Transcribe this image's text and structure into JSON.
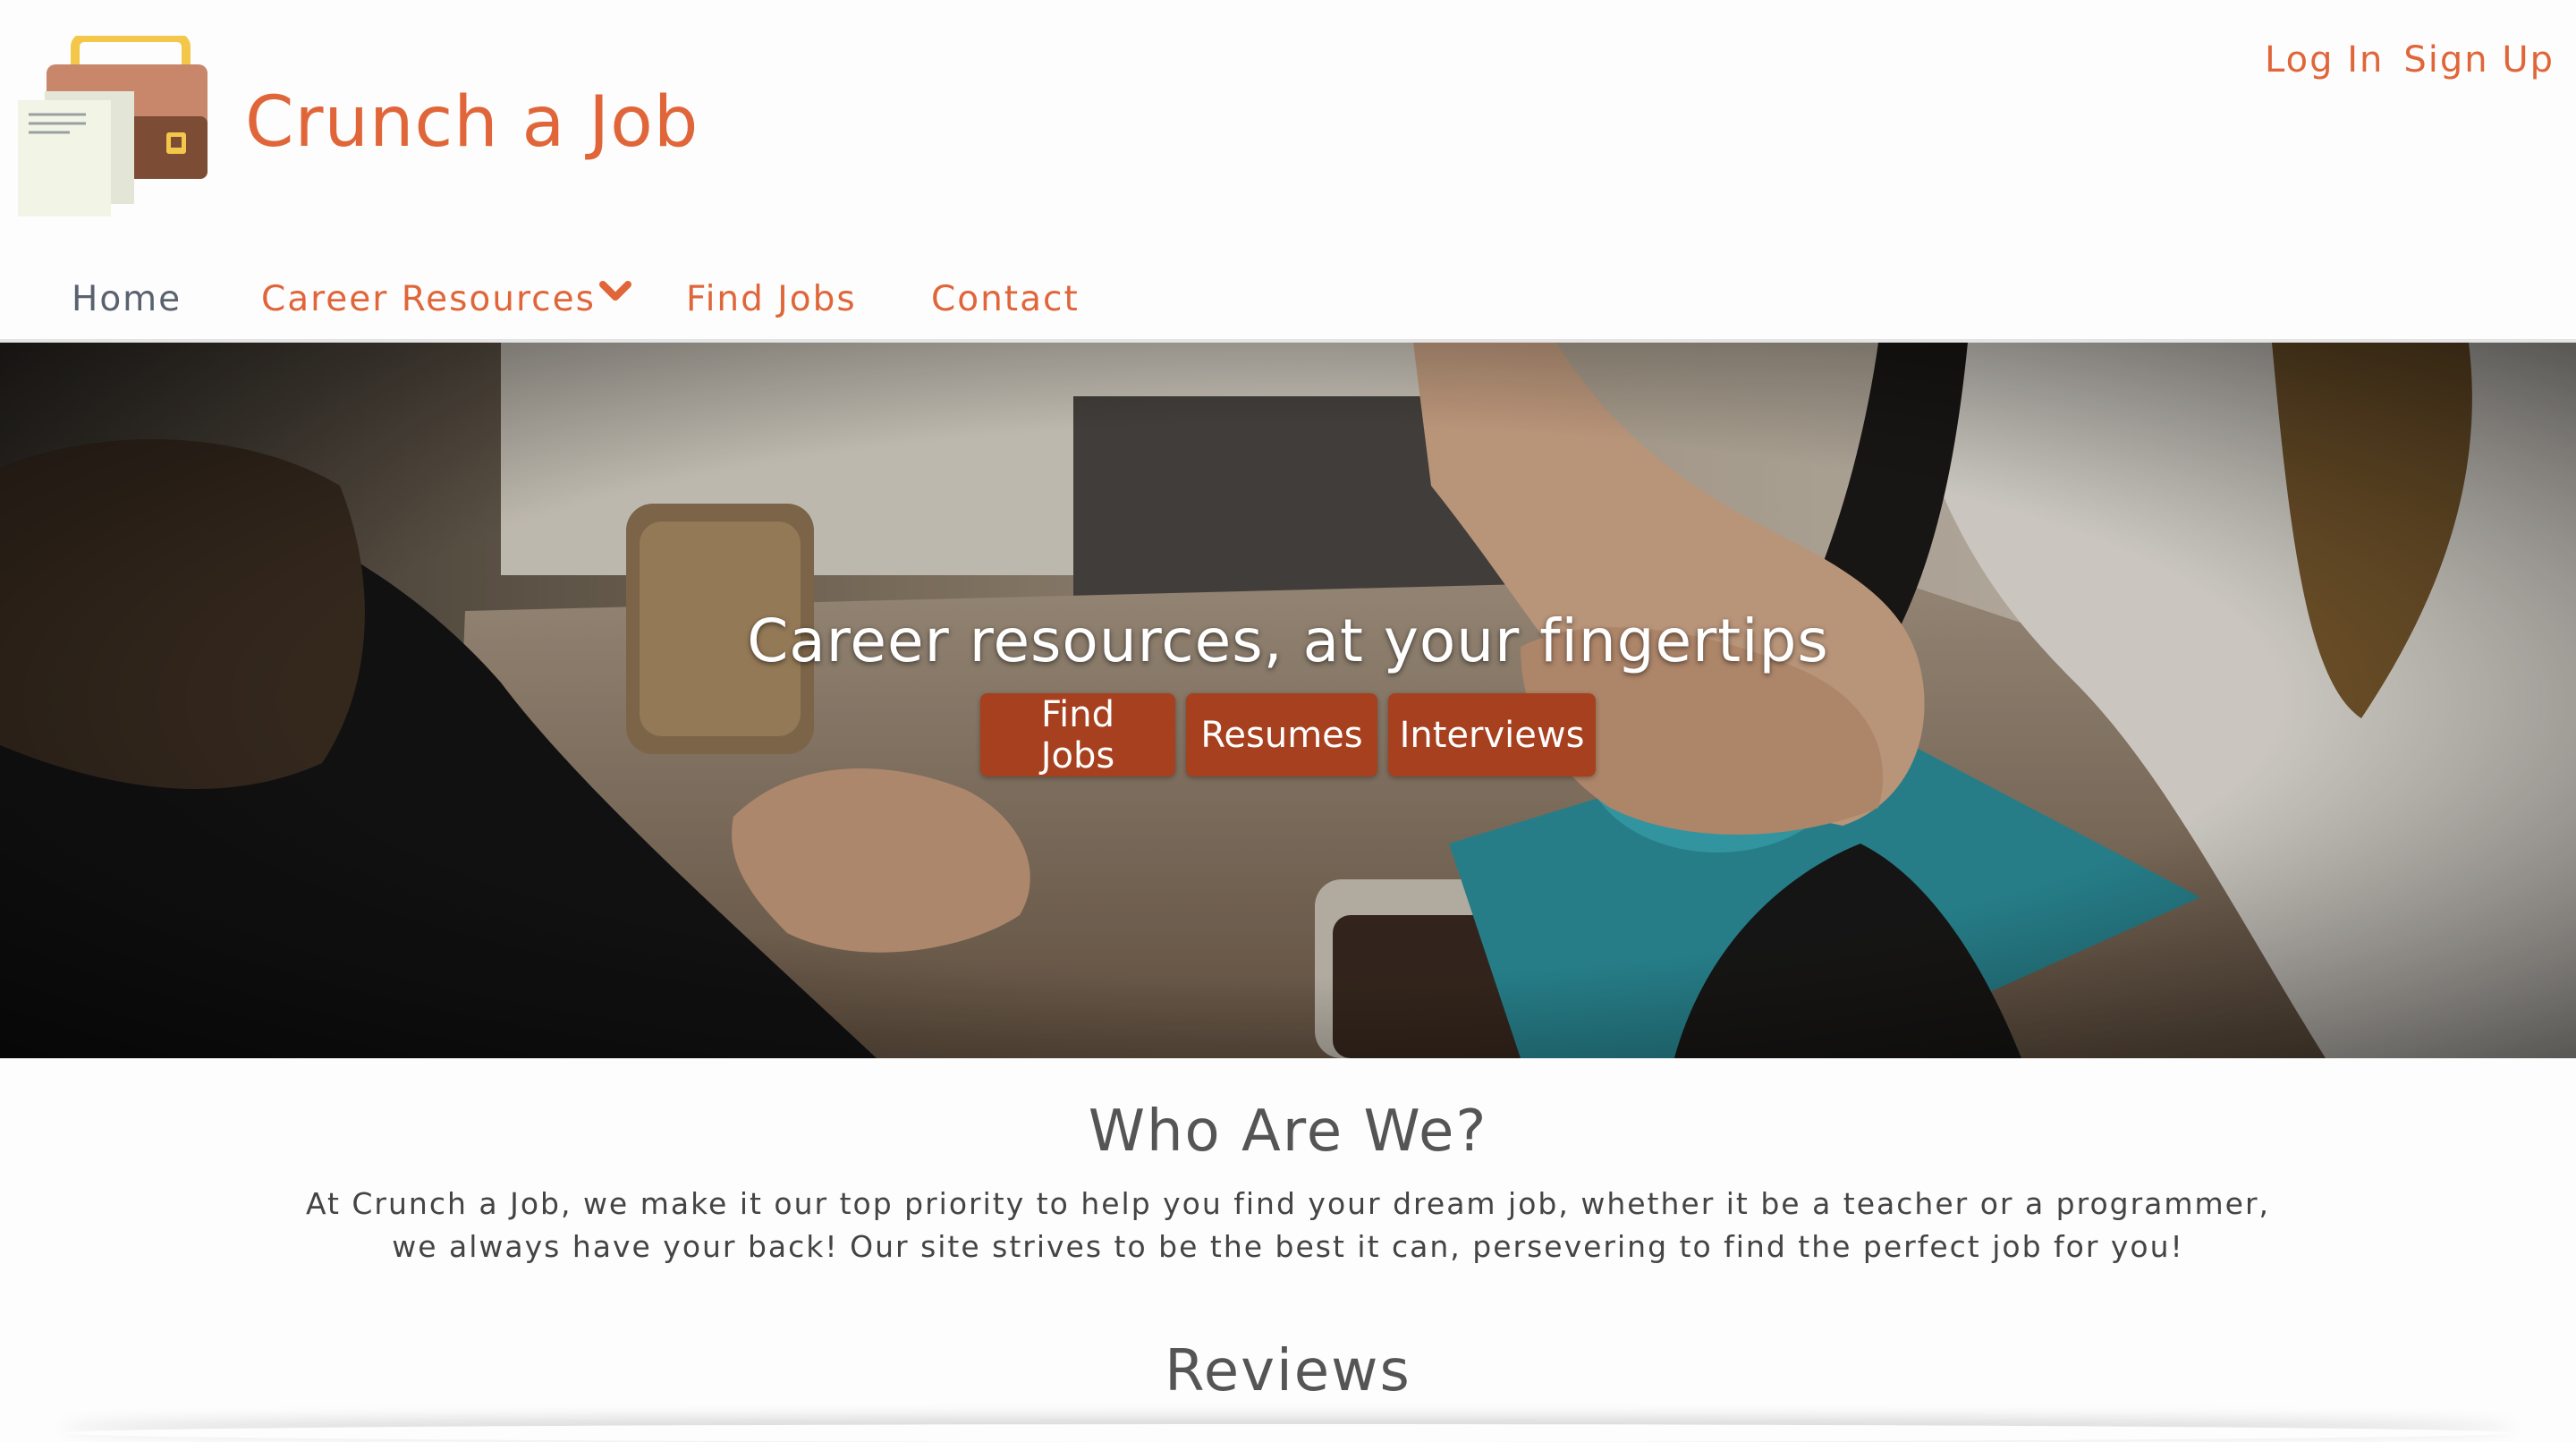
{
  "brand": {
    "name": "Crunch a Job",
    "color": "#e0663a"
  },
  "auth": {
    "login": "Log In",
    "signup": "Sign Up"
  },
  "nav": {
    "home": "Home",
    "career_resources": "Career Resources",
    "find_jobs": "Find Jobs",
    "contact": "Contact"
  },
  "icons": {
    "logo": "briefcase-with-documents-icon",
    "dropdown": "chevron-down-icon"
  },
  "hero": {
    "title": "Career resources, at your fingertips",
    "buttons": [
      "Find Jobs",
      "Resumes",
      "Interviews"
    ],
    "button_color": "#a7401e"
  },
  "about": {
    "title": "Who Are We?",
    "text": "At Crunch a Job, we make it our top priority to help you find your dream job, whether it be a teacher or a programmer, we always have your back! Our site strives to be the best it can, persevering to find the perfect job for you!"
  },
  "reviews": {
    "title": "Reviews"
  }
}
